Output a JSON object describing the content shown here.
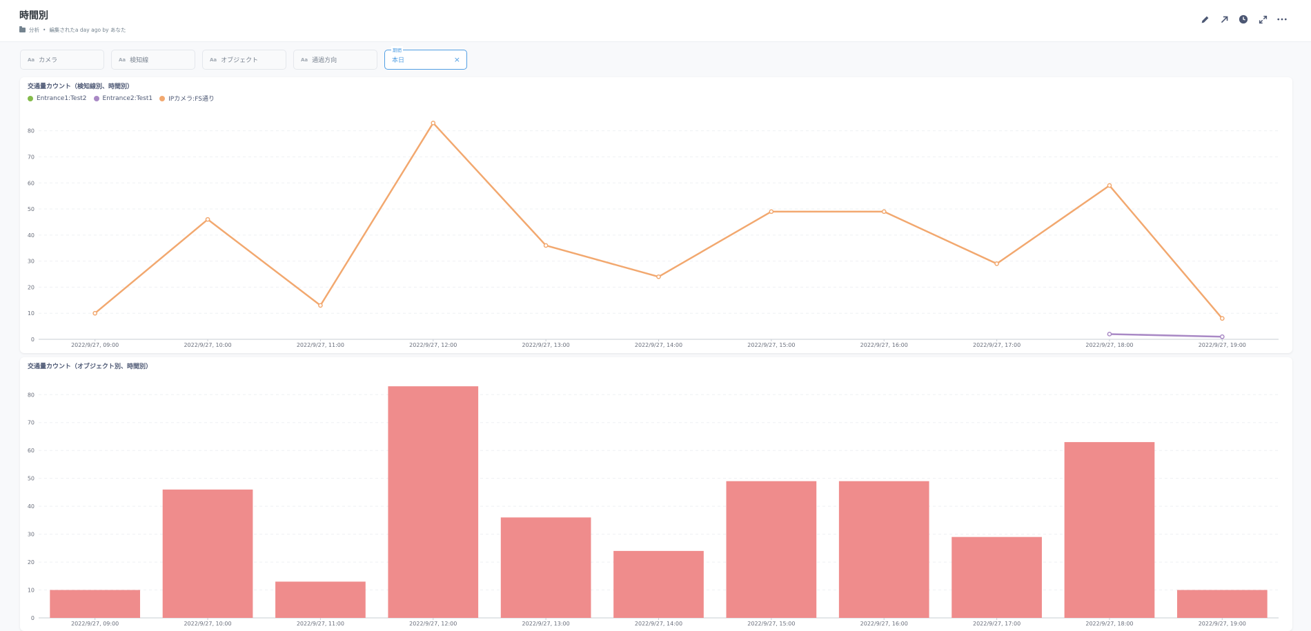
{
  "header": {
    "title": "時間別",
    "breadcrumb_collection": "分析",
    "breadcrumb_separator": "•",
    "breadcrumb_edited": "編集されたa day ago by あなた",
    "icons": [
      "pencil-icon",
      "arrow-up-right-icon",
      "clock-icon",
      "expand-icon",
      "more-icon"
    ]
  },
  "filters": [
    {
      "prefix": "Aa",
      "label": "カメラ"
    },
    {
      "prefix": "Aa",
      "label": "検知線"
    },
    {
      "prefix": "Aa",
      "label": "オブジェクト"
    },
    {
      "prefix": "Aa",
      "label": "通過方向"
    }
  ],
  "active_filter": {
    "title": "期間",
    "value": "本日",
    "clear": "×"
  },
  "colors": {
    "orange": "#f2a86f",
    "purple": "#a989c5",
    "green": "#84bb4c",
    "bar": "#ef8c8c",
    "accent": "#509ee3"
  },
  "chart_data": [
    {
      "type": "line",
      "title": "交通量カウント（検知線別、時間別）",
      "categories": [
        "2022/9/27, 09:00",
        "2022/9/27, 10:00",
        "2022/9/27, 11:00",
        "2022/9/27, 12:00",
        "2022/9/27, 13:00",
        "2022/9/27, 14:00",
        "2022/9/27, 15:00",
        "2022/9/27, 16:00",
        "2022/9/27, 17:00",
        "2022/9/27, 18:00",
        "2022/9/27, 19:00"
      ],
      "series": [
        {
          "name": "Entrance1:Test2",
          "color": "#84bb4c",
          "values": [
            null,
            null,
            null,
            null,
            null,
            null,
            null,
            null,
            null,
            null,
            null
          ]
        },
        {
          "name": "Entrance2:Test1",
          "color": "#a989c5",
          "values": [
            null,
            null,
            null,
            null,
            null,
            null,
            null,
            null,
            null,
            2,
            1
          ]
        },
        {
          "name": "IPカメラ:FS通り",
          "color": "#f2a86f",
          "values": [
            10,
            46,
            13,
            83,
            36,
            24,
            49,
            49,
            29,
            59,
            8
          ]
        }
      ],
      "yticks": [
        0,
        10,
        20,
        30,
        40,
        50,
        60,
        70,
        80
      ],
      "ylim": [
        0,
        86
      ],
      "legend": "top-left"
    },
    {
      "type": "bar",
      "title": "交通量カウント（オブジェクト別、時間別）",
      "categories": [
        "2022/9/27, 09:00",
        "2022/9/27, 10:00",
        "2022/9/27, 11:00",
        "2022/9/27, 12:00",
        "2022/9/27, 13:00",
        "2022/9/27, 14:00",
        "2022/9/27, 15:00",
        "2022/9/27, 16:00",
        "2022/9/27, 17:00",
        "2022/9/27, 18:00",
        "2022/9/27, 19:00"
      ],
      "values": [
        10,
        46,
        13,
        83,
        36,
        24,
        49,
        49,
        29,
        63,
        10
      ],
      "color": "#ef8c8c",
      "yticks": [
        0,
        10,
        20,
        30,
        40,
        50,
        60,
        70,
        80
      ],
      "ylim": [
        0,
        86
      ]
    }
  ]
}
